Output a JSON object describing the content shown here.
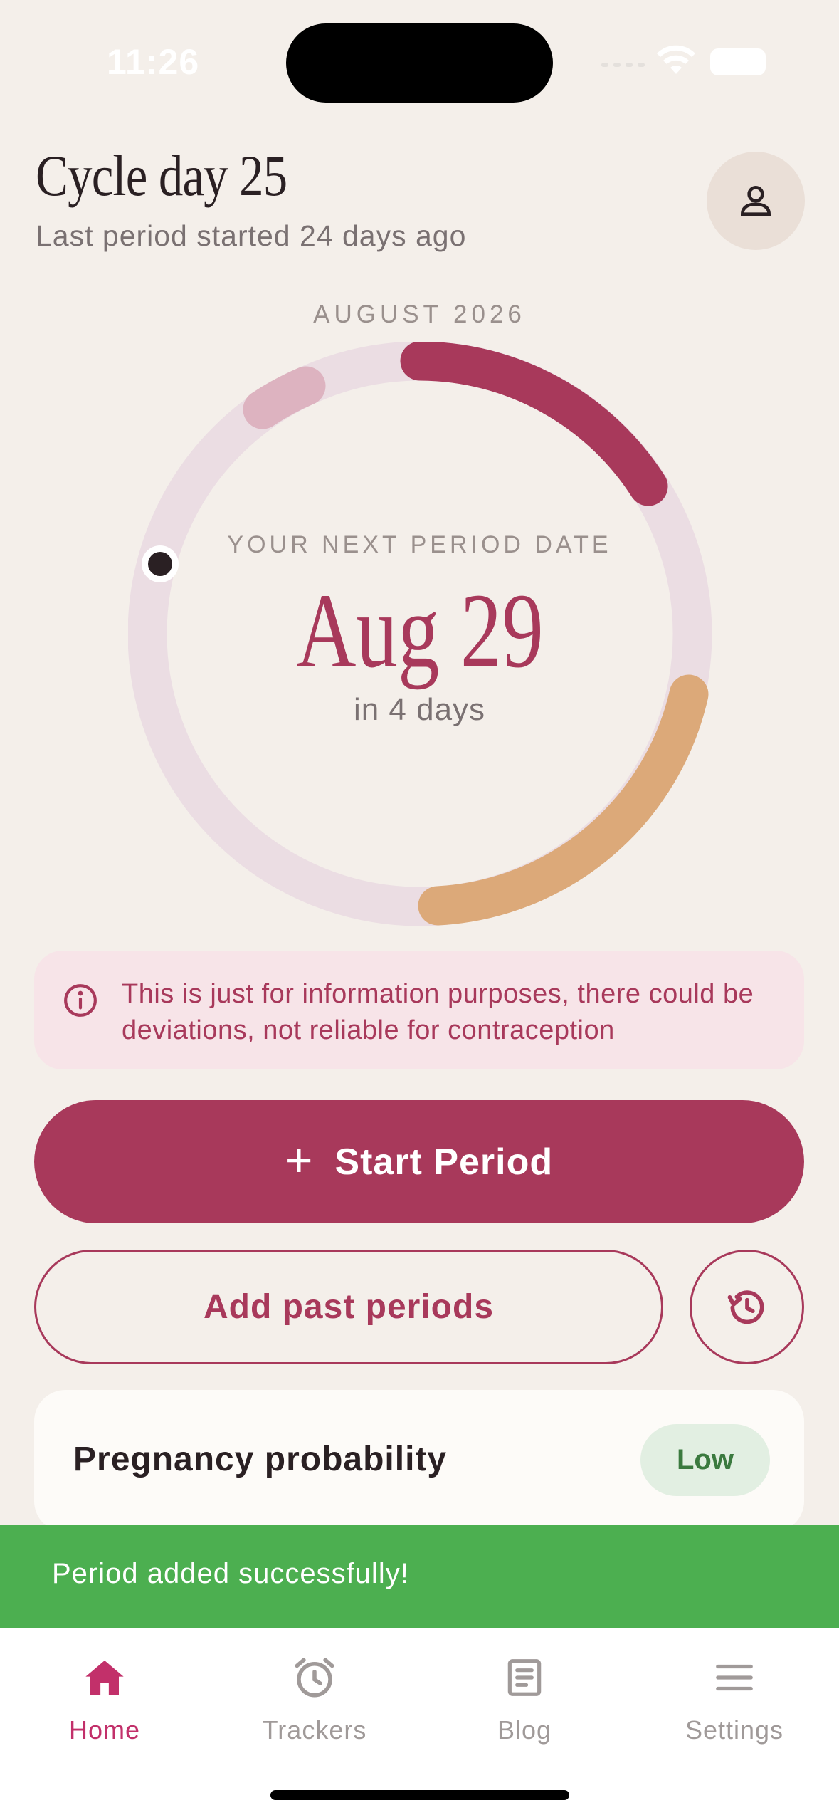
{
  "status_bar": {
    "time": "11:26"
  },
  "header": {
    "title": "Cycle day 25",
    "subtitle": "Last period started 24 days ago",
    "profile_icon": "person-icon"
  },
  "cycle": {
    "month": "AUGUST 2026",
    "next_label": "YOUR NEXT PERIOD DATE",
    "next_date": "Aug 29",
    "countdown": "in 4 days",
    "colors": {
      "period": "#a8395b",
      "fertile": "#dca979",
      "past": "#ddb3c0",
      "track": "#ebdde3",
      "current_marker": "#2a2023"
    }
  },
  "disclaimer": {
    "icon": "info-icon",
    "text": "This is just for information purposes, there could be deviations, not reliable for contraception"
  },
  "actions": {
    "start_label": "Start Period",
    "start_icon": "plus-icon",
    "past_label": "Add past periods",
    "history_icon": "history-icon"
  },
  "pregnancy": {
    "title": "Pregnancy probability",
    "level": "Low"
  },
  "toast": {
    "message": "Period added successfully!"
  },
  "tabs": [
    {
      "label": "Home",
      "icon": "home-icon",
      "active": true
    },
    {
      "label": "Trackers",
      "icon": "alarm-clock-icon",
      "active": false
    },
    {
      "label": "Blog",
      "icon": "article-icon",
      "active": false
    },
    {
      "label": "Settings",
      "icon": "menu-icon",
      "active": false
    }
  ],
  "theme": {
    "background": "#f4efea",
    "accent": "#a8395b",
    "success": "#4caf50"
  }
}
